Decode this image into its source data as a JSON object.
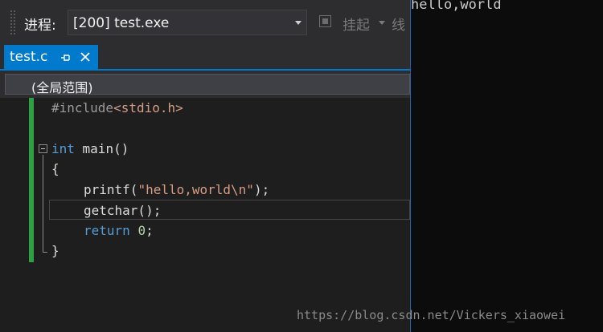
{
  "toolbar": {
    "process_label": "进程:",
    "process_value": "[200] test.exe",
    "suspend_label": "挂起",
    "thread_label": "线"
  },
  "tab": {
    "title": "test.c"
  },
  "scope": {
    "label": "(全局范围)"
  },
  "code_lines": {
    "l1": {
      "pp": "#include",
      "rest": "<stdio.h>"
    },
    "l3": {
      "kw": "int",
      "rest": " main()"
    },
    "l4": "{",
    "l5": {
      "fn": "printf(",
      "str": "\"hello,world\\n\"",
      "end": ");"
    },
    "l6": "getchar();",
    "l7": {
      "kw": "return",
      "sp": " ",
      "num": "0",
      "end": ";"
    },
    "l8": "}"
  },
  "console": {
    "output": "hello,world"
  },
  "watermark": "https://blog.csdn.net/Vickers_xiaowei",
  "colors": {
    "accent": "#007acc",
    "keyword": "#569cd6",
    "string": "#d69d85",
    "change_marker": "#2ea043"
  },
  "icons": [
    "pin-icon",
    "close-icon",
    "suspend-icon",
    "dropdown-arrow-icon",
    "fold-icon"
  ]
}
